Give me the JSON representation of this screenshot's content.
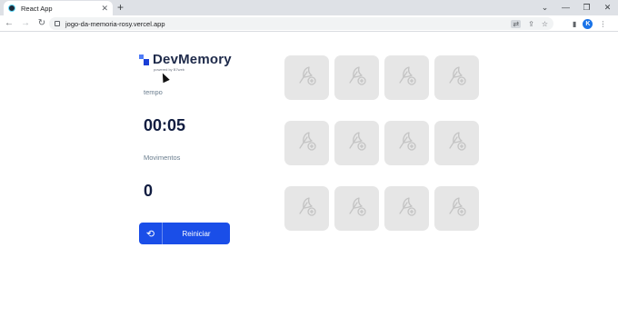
{
  "browser": {
    "tab_title": "React App",
    "url": "jogo-da-memoria-rosy.vercel.app",
    "profile_initial": "K"
  },
  "app": {
    "logo_text": "DevMemory",
    "logo_sub": "powered by B7web",
    "time_label": "tempo",
    "time_value": "00:05",
    "moves_label": "Movimentos",
    "moves_value": "0",
    "restart_label": "Reiniciar",
    "colors": {
      "accent": "#1a4ee8",
      "card_back": "#e6e6e6",
      "title": "#101c40"
    }
  },
  "cards": [
    {
      "icon": "card-back-icon",
      "flipped": false
    },
    {
      "icon": "card-back-icon",
      "flipped": false
    },
    {
      "icon": "card-back-icon",
      "flipped": false
    },
    {
      "icon": "card-back-icon",
      "flipped": false
    },
    {
      "icon": "card-back-icon",
      "flipped": false
    },
    {
      "icon": "card-back-icon",
      "flipped": false
    },
    {
      "icon": "card-back-icon",
      "flipped": false
    },
    {
      "icon": "card-back-icon",
      "flipped": false
    },
    {
      "icon": "card-back-icon",
      "flipped": false
    },
    {
      "icon": "card-back-icon",
      "flipped": false
    },
    {
      "icon": "card-back-icon",
      "flipped": false
    },
    {
      "icon": "card-back-icon",
      "flipped": false
    }
  ]
}
